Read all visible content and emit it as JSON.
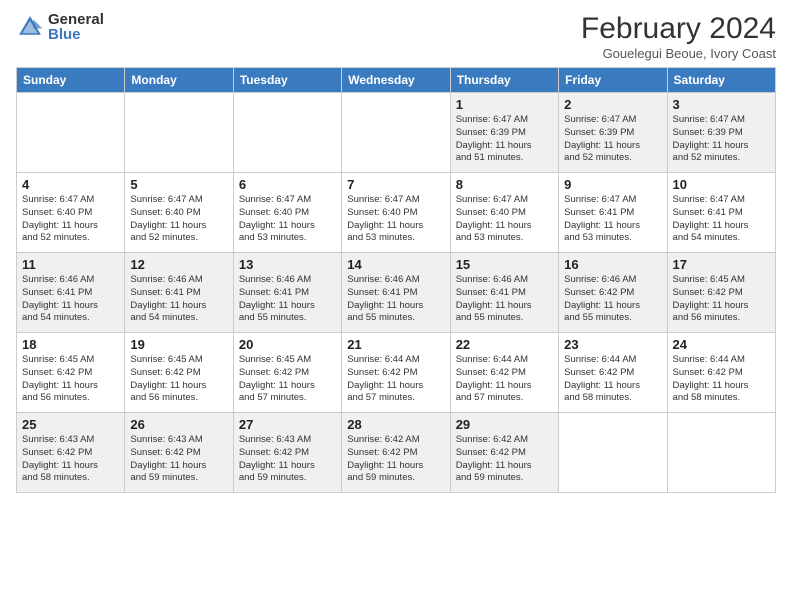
{
  "logo": {
    "general": "General",
    "blue": "Blue"
  },
  "title": {
    "month": "February 2024",
    "location": "Gouelegui Beoue, Ivory Coast"
  },
  "weekdays": [
    "Sunday",
    "Monday",
    "Tuesday",
    "Wednesday",
    "Thursday",
    "Friday",
    "Saturday"
  ],
  "weeks": [
    [
      {
        "day": "",
        "detail": ""
      },
      {
        "day": "",
        "detail": ""
      },
      {
        "day": "",
        "detail": ""
      },
      {
        "day": "",
        "detail": ""
      },
      {
        "day": "1",
        "detail": "Sunrise: 6:47 AM\nSunset: 6:39 PM\nDaylight: 11 hours\nand 51 minutes."
      },
      {
        "day": "2",
        "detail": "Sunrise: 6:47 AM\nSunset: 6:39 PM\nDaylight: 11 hours\nand 52 minutes."
      },
      {
        "day": "3",
        "detail": "Sunrise: 6:47 AM\nSunset: 6:39 PM\nDaylight: 11 hours\nand 52 minutes."
      }
    ],
    [
      {
        "day": "4",
        "detail": "Sunrise: 6:47 AM\nSunset: 6:40 PM\nDaylight: 11 hours\nand 52 minutes."
      },
      {
        "day": "5",
        "detail": "Sunrise: 6:47 AM\nSunset: 6:40 PM\nDaylight: 11 hours\nand 52 minutes."
      },
      {
        "day": "6",
        "detail": "Sunrise: 6:47 AM\nSunset: 6:40 PM\nDaylight: 11 hours\nand 53 minutes."
      },
      {
        "day": "7",
        "detail": "Sunrise: 6:47 AM\nSunset: 6:40 PM\nDaylight: 11 hours\nand 53 minutes."
      },
      {
        "day": "8",
        "detail": "Sunrise: 6:47 AM\nSunset: 6:40 PM\nDaylight: 11 hours\nand 53 minutes."
      },
      {
        "day": "9",
        "detail": "Sunrise: 6:47 AM\nSunset: 6:41 PM\nDaylight: 11 hours\nand 53 minutes."
      },
      {
        "day": "10",
        "detail": "Sunrise: 6:47 AM\nSunset: 6:41 PM\nDaylight: 11 hours\nand 54 minutes."
      }
    ],
    [
      {
        "day": "11",
        "detail": "Sunrise: 6:46 AM\nSunset: 6:41 PM\nDaylight: 11 hours\nand 54 minutes."
      },
      {
        "day": "12",
        "detail": "Sunrise: 6:46 AM\nSunset: 6:41 PM\nDaylight: 11 hours\nand 54 minutes."
      },
      {
        "day": "13",
        "detail": "Sunrise: 6:46 AM\nSunset: 6:41 PM\nDaylight: 11 hours\nand 55 minutes."
      },
      {
        "day": "14",
        "detail": "Sunrise: 6:46 AM\nSunset: 6:41 PM\nDaylight: 11 hours\nand 55 minutes."
      },
      {
        "day": "15",
        "detail": "Sunrise: 6:46 AM\nSunset: 6:41 PM\nDaylight: 11 hours\nand 55 minutes."
      },
      {
        "day": "16",
        "detail": "Sunrise: 6:46 AM\nSunset: 6:42 PM\nDaylight: 11 hours\nand 55 minutes."
      },
      {
        "day": "17",
        "detail": "Sunrise: 6:45 AM\nSunset: 6:42 PM\nDaylight: 11 hours\nand 56 minutes."
      }
    ],
    [
      {
        "day": "18",
        "detail": "Sunrise: 6:45 AM\nSunset: 6:42 PM\nDaylight: 11 hours\nand 56 minutes."
      },
      {
        "day": "19",
        "detail": "Sunrise: 6:45 AM\nSunset: 6:42 PM\nDaylight: 11 hours\nand 56 minutes."
      },
      {
        "day": "20",
        "detail": "Sunrise: 6:45 AM\nSunset: 6:42 PM\nDaylight: 11 hours\nand 57 minutes."
      },
      {
        "day": "21",
        "detail": "Sunrise: 6:44 AM\nSunset: 6:42 PM\nDaylight: 11 hours\nand 57 minutes."
      },
      {
        "day": "22",
        "detail": "Sunrise: 6:44 AM\nSunset: 6:42 PM\nDaylight: 11 hours\nand 57 minutes."
      },
      {
        "day": "23",
        "detail": "Sunrise: 6:44 AM\nSunset: 6:42 PM\nDaylight: 11 hours\nand 58 minutes."
      },
      {
        "day": "24",
        "detail": "Sunrise: 6:44 AM\nSunset: 6:42 PM\nDaylight: 11 hours\nand 58 minutes."
      }
    ],
    [
      {
        "day": "25",
        "detail": "Sunrise: 6:43 AM\nSunset: 6:42 PM\nDaylight: 11 hours\nand 58 minutes."
      },
      {
        "day": "26",
        "detail": "Sunrise: 6:43 AM\nSunset: 6:42 PM\nDaylight: 11 hours\nand 59 minutes."
      },
      {
        "day": "27",
        "detail": "Sunrise: 6:43 AM\nSunset: 6:42 PM\nDaylight: 11 hours\nand 59 minutes."
      },
      {
        "day": "28",
        "detail": "Sunrise: 6:42 AM\nSunset: 6:42 PM\nDaylight: 11 hours\nand 59 minutes."
      },
      {
        "day": "29",
        "detail": "Sunrise: 6:42 AM\nSunset: 6:42 PM\nDaylight: 11 hours\nand 59 minutes."
      },
      {
        "day": "",
        "detail": ""
      },
      {
        "day": "",
        "detail": ""
      }
    ]
  ]
}
